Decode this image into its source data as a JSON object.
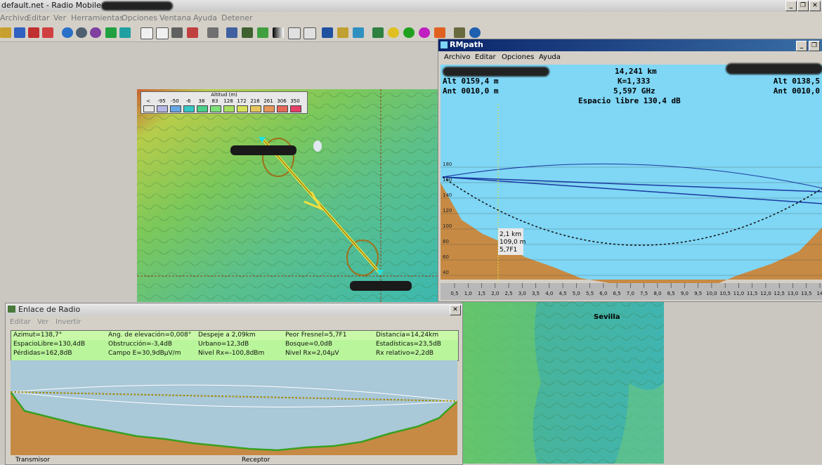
{
  "main": {
    "title": "default.net - Radio Mobile -",
    "menu": [
      "Archivo",
      "Editar",
      "Ver",
      "Herramientas",
      "Opciones",
      "Ventana",
      "Ayuda",
      "Detener"
    ],
    "window_buttons": [
      "_",
      "Ē",
      "X"
    ]
  },
  "map": {
    "legend": {
      "title": "Altitud (m)",
      "labels": [
        "<",
        "-95",
        "-50",
        "-6",
        "38",
        "83",
        "128",
        "172",
        "216",
        "261",
        "306",
        "350"
      ],
      "colors": [
        "#e6e6e6",
        "#b6b6e6",
        "#66a6e6",
        "#36c6c6",
        "#4ad08a",
        "#7ee07a",
        "#a6e05e",
        "#d6e05a",
        "#e6c65a",
        "#e6965a",
        "#e66a5a",
        "#e6406a"
      ]
    },
    "city_label": "Sevilla"
  },
  "rmpath": {
    "title": "RMpath",
    "menu": [
      "Archivo",
      "Editar",
      "Opciones",
      "Ayuda"
    ],
    "distance": "14,241 km",
    "k_factor": "K=1,333",
    "frequency": "5,597 GHz",
    "free_space": "Espacio libre 130,4 dB",
    "alt_left": "Alt 0159,4 m",
    "ant_left": "Ant 0010,0 m",
    "alt_right": "Alt 0138,5",
    "ant_right": "Ant 0010,0",
    "cursor_info": [
      "2,1 km",
      "109,0 m",
      "5,7F1"
    ],
    "y_ticks": [
      "180",
      "160",
      "140",
      "120",
      "100",
      "80",
      "60",
      "40",
      "20"
    ],
    "x_ticks": [
      "0,5",
      "1,0",
      "1,5",
      "2,0",
      "2,5",
      "3,0",
      "3,5",
      "4,0",
      "4,5",
      "5,0",
      "5,5",
      "6,0",
      "6,5",
      "7,0",
      "7,5",
      "8,0",
      "8,5",
      "9,0",
      "9,5",
      "10,0",
      "10,5",
      "11,0",
      "11,5",
      "12,0",
      "12,5",
      "13,0",
      "13,5",
      "14"
    ]
  },
  "enlace": {
    "title": "Enlace de Radio",
    "menu": [
      "Editar",
      "Ver",
      "Invertir"
    ],
    "rows": [
      [
        "Azimut=138,7°",
        "Ang. de elevación=0,008°",
        "Despeje a 2,09km",
        "Peor Fresnel=5,7F1",
        "Distancia=14,24km"
      ],
      [
        "EspacioLibre=130,4dB",
        "Obstrucción=-3,4dB",
        "Urbano=12,3dB",
        "Bosque=0,0dB",
        "Estadísticas=23,5dB"
      ],
      [
        "Pérdidas=162,8dB",
        "Campo E=30,9dBµV/m",
        "Nivel Rx=-100,8dBm",
        "Nivel Rx=2,04µV",
        "Rx relativo=2,2dB"
      ]
    ],
    "bottom": [
      "Transmisor",
      "Receptor"
    ]
  },
  "colors": {
    "terrain": "#c68a44",
    "sky": "#7fd6f5",
    "title_active": "#0a246a",
    "grid_green": "#b9f59a"
  }
}
